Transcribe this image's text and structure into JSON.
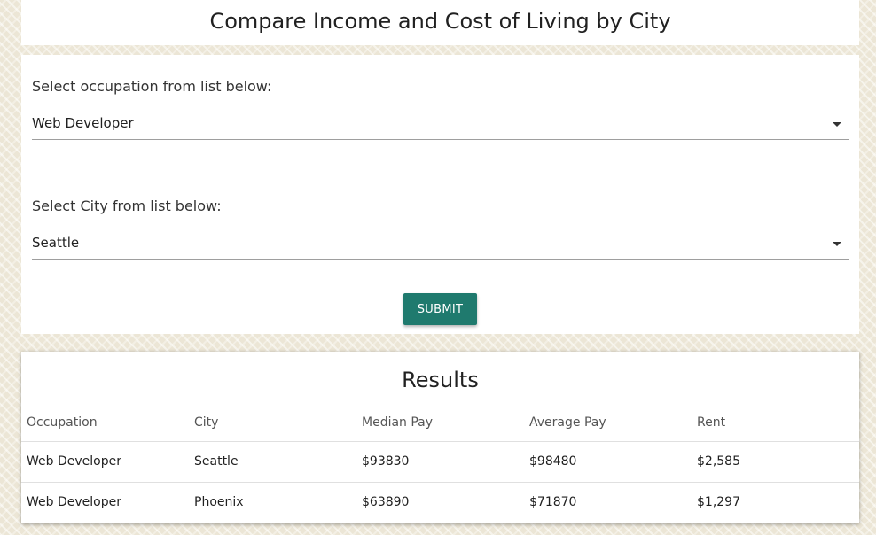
{
  "header": {
    "title": "Compare Income and Cost of Living by City"
  },
  "form": {
    "occupation_label": "Select occupation from list below:",
    "occupation_value": "Web Developer",
    "city_label": "Select City from list below:",
    "city_value": "Seattle",
    "submit_label": "SUBMIT",
    "submit_color": "#1f7a6e"
  },
  "results": {
    "title": "Results",
    "columns": [
      "Occupation",
      "City",
      "Median Pay",
      "Average Pay",
      "Rent"
    ],
    "rows": [
      [
        "Web Developer",
        "Seattle",
        "$93830",
        "$98480",
        "$2,585"
      ],
      [
        "Web Developer",
        "Phoenix",
        "$63890",
        "$71870",
        "$1,297"
      ]
    ]
  }
}
